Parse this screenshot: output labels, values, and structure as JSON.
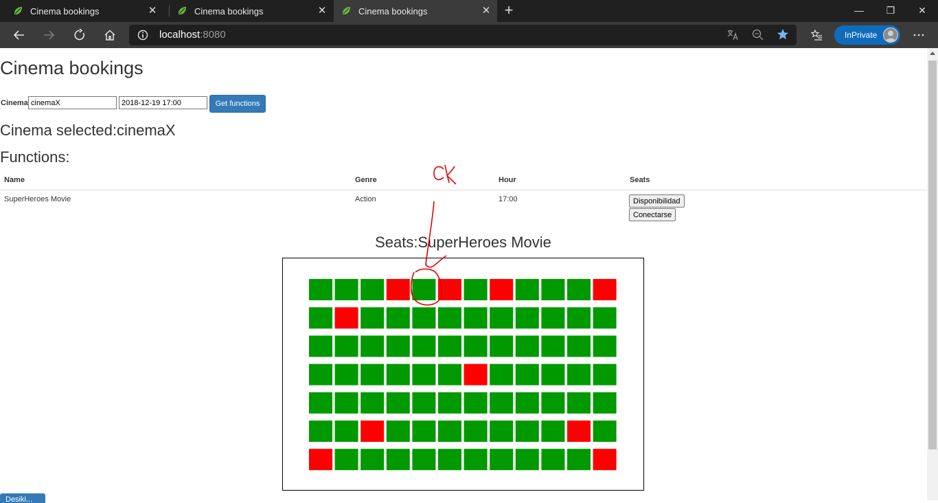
{
  "browser": {
    "tabs": [
      {
        "title": "Cinema bookings",
        "active": false
      },
      {
        "title": "Cinema bookings",
        "active": false
      },
      {
        "title": "Cinema bookings",
        "active": true
      }
    ],
    "address": {
      "host": "localhost",
      "port": ":8080"
    },
    "inprivate_label": "InPrivate"
  },
  "page": {
    "title": "Cinema bookings",
    "form": {
      "cinema_label": "Cinema",
      "cinema_value": "cinemaX",
      "date_value": "2018-12-19 17:00",
      "get_functions_label": "Get functions"
    },
    "cinema_selected": "Cinema selected:cinemaX",
    "functions_heading": "Functions:",
    "table": {
      "headers": [
        "Name",
        "Genre",
        "Hour",
        "Seats"
      ],
      "rows": [
        {
          "name": "SuperHeroes Movie",
          "genre": "Action",
          "hour": "17:00"
        }
      ],
      "availability_button": "Disponibilidad",
      "connect_button": "Conectarse"
    },
    "seats_title": "Seats:SuperHeroes Movie",
    "seat_colors": {
      "available": "#009900",
      "occupied": "#ff0000"
    },
    "seats": [
      [
        1,
        1,
        1,
        0,
        1,
        0,
        1,
        0,
        1,
        1,
        1,
        0
      ],
      [
        1,
        0,
        1,
        1,
        1,
        1,
        1,
        1,
        1,
        1,
        1,
        1
      ],
      [
        1,
        1,
        1,
        1,
        1,
        1,
        1,
        1,
        1,
        1,
        1,
        1
      ],
      [
        1,
        1,
        1,
        1,
        1,
        1,
        0,
        1,
        1,
        1,
        1,
        1
      ],
      [
        1,
        1,
        1,
        1,
        1,
        1,
        1,
        1,
        1,
        1,
        1,
        1
      ],
      [
        1,
        1,
        0,
        1,
        1,
        1,
        1,
        1,
        1,
        1,
        0,
        1
      ],
      [
        0,
        1,
        1,
        1,
        1,
        1,
        1,
        1,
        1,
        1,
        1,
        0
      ]
    ],
    "bottom_button": "Desiki..."
  }
}
